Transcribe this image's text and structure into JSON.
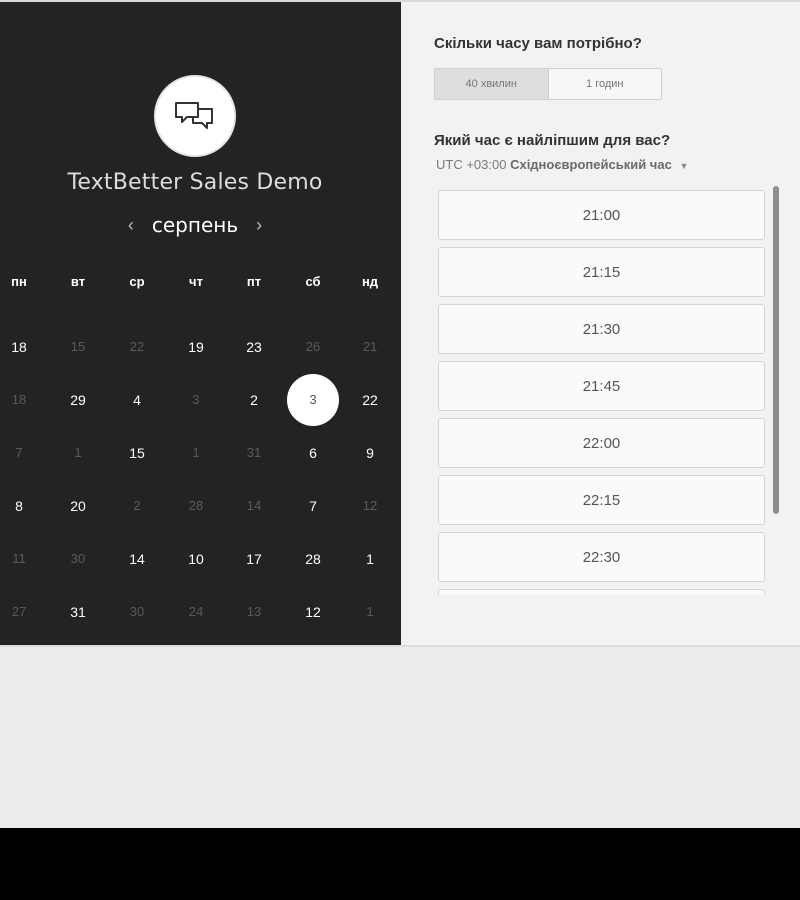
{
  "product": {
    "title": "TextBetter Sales Demo",
    "logo_icon": "chat-bubbles-icon"
  },
  "calendar": {
    "month": "серпень",
    "prev_icon": "chevron-left-icon",
    "next_icon": "chevron-right-icon",
    "weekdays": [
      "пн",
      "вт",
      "ср",
      "чт",
      "пт",
      "сб",
      "нд"
    ],
    "rows": [
      [
        {
          "d": "18",
          "a": 1
        },
        {
          "d": "15",
          "a": 0
        },
        {
          "d": "22",
          "a": 0
        },
        {
          "d": "19",
          "a": 1
        },
        {
          "d": "23",
          "a": 1
        },
        {
          "d": "26",
          "a": 0
        },
        {
          "d": "21",
          "a": 0
        }
      ],
      [
        {
          "d": "18",
          "a": 0
        },
        {
          "d": "29",
          "a": 1
        },
        {
          "d": "4",
          "a": 1
        },
        {
          "d": "3",
          "a": 0
        },
        {
          "d": "2",
          "a": 1
        },
        {
          "d": "3",
          "a": 2
        },
        {
          "d": "22",
          "a": 1
        }
      ],
      [
        {
          "d": "7",
          "a": 0
        },
        {
          "d": "1",
          "a": 0
        },
        {
          "d": "15",
          "a": 1
        },
        {
          "d": "1",
          "a": 0
        },
        {
          "d": "31",
          "a": 0
        },
        {
          "d": "6",
          "a": 1
        },
        {
          "d": "9",
          "a": 1
        }
      ],
      [
        {
          "d": "8",
          "a": 1
        },
        {
          "d": "20",
          "a": 1
        },
        {
          "d": "2",
          "a": 0
        },
        {
          "d": "28",
          "a": 0
        },
        {
          "d": "14",
          "a": 0
        },
        {
          "d": "7",
          "a": 1
        },
        {
          "d": "12",
          "a": 0
        }
      ],
      [
        {
          "d": "11",
          "a": 0
        },
        {
          "d": "30",
          "a": 0
        },
        {
          "d": "14",
          "a": 1
        },
        {
          "d": "10",
          "a": 1
        },
        {
          "d": "17",
          "a": 1
        },
        {
          "d": "28",
          "a": 1
        },
        {
          "d": "1",
          "a": 1
        }
      ],
      [
        {
          "d": "27",
          "a": 0
        },
        {
          "d": "31",
          "a": 1
        },
        {
          "d": "30",
          "a": 0
        },
        {
          "d": "24",
          "a": 0
        },
        {
          "d": "13",
          "a": 0
        },
        {
          "d": "12",
          "a": 1
        },
        {
          "d": "1",
          "a": 0
        }
      ]
    ]
  },
  "duration": {
    "heading": "Скільки часу вам потрібно?",
    "options": [
      "40 хвилин",
      "1 годин"
    ],
    "selected": "40 хвилин"
  },
  "timeslots": {
    "heading": "Який час є найліпшим для вас?",
    "tz_offset": "UTC +03:00",
    "tz_name": "Східноєвропейський час",
    "slots": [
      "21:00",
      "21:15",
      "21:30",
      "21:45",
      "22:00",
      "22:15",
      "22:30",
      ""
    ]
  }
}
